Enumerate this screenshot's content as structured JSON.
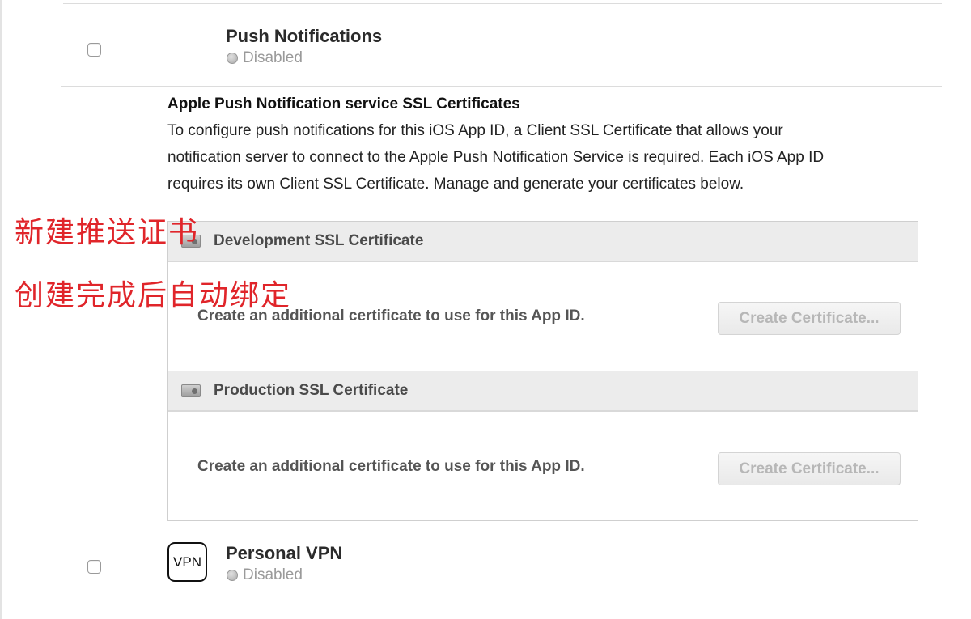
{
  "push_notifications": {
    "name": "Push Notifications",
    "status": "Disabled"
  },
  "ssl_section": {
    "title": "Apple Push Notification service SSL Certificates",
    "description_lines": [
      "To configure push notifications for this iOS App ID, a Client SSL Certificate that allows your",
      "notification server to connect to the Apple Push Notification Service is required. Each iOS App ID",
      "requires its own Client SSL Certificate. Manage and generate your certificates below."
    ]
  },
  "annotations": {
    "line1": "新建推送证书",
    "line2": "创建完成后自动绑定"
  },
  "development_cert": {
    "title": "Development SSL Certificate",
    "body_text": "Create an additional certificate to use for this App ID.",
    "button_label": "Create Certificate..."
  },
  "production_cert": {
    "title": "Production SSL Certificate",
    "body_text": "Create an additional certificate to use for this App ID.",
    "button_label": "Create Certificate..."
  },
  "personal_vpn": {
    "name": "Personal VPN",
    "status": "Disabled",
    "icon_text": "VPN"
  },
  "colors": {
    "annotation": "#e0252a",
    "disabled_button_text": "#b7b7b7",
    "status_text": "#9a9a9a"
  }
}
